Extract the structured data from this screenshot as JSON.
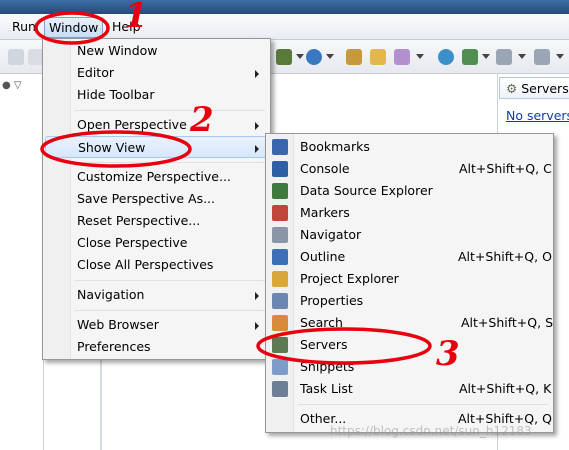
{
  "menubar": {
    "run": "Run",
    "window": "Window",
    "help": "Help"
  },
  "colors": {
    "annotation": "#e8000e",
    "highlight": "#d6e7fb",
    "link": "#0b3fa8"
  },
  "window_menu": {
    "items": [
      {
        "label": "New Window"
      },
      {
        "label": "Editor",
        "submenu": true
      },
      {
        "label": "Hide Toolbar"
      },
      {
        "label": "Open Perspective",
        "submenu": true
      },
      {
        "label": "Show View",
        "submenu": true,
        "highlighted": true
      },
      {
        "label": "Customize Perspective..."
      },
      {
        "label": "Save Perspective As..."
      },
      {
        "label": "Reset Perspective..."
      },
      {
        "label": "Close Perspective"
      },
      {
        "label": "Close All Perspectives"
      },
      {
        "label": "Navigation",
        "submenu": true
      },
      {
        "label": "Web Browser",
        "submenu": true
      },
      {
        "label": "Preferences"
      }
    ]
  },
  "show_view_menu": {
    "items": [
      {
        "label": "Bookmarks",
        "icon": "bookmarks-icon",
        "accel": ""
      },
      {
        "label": "Console",
        "icon": "console-icon",
        "accel": "Alt+Shift+Q, C"
      },
      {
        "label": "Data Source Explorer",
        "icon": "data-source-icon",
        "accel": ""
      },
      {
        "label": "Markers",
        "icon": "markers-icon",
        "accel": ""
      },
      {
        "label": "Navigator",
        "icon": "navigator-icon",
        "accel": ""
      },
      {
        "label": "Outline",
        "icon": "outline-icon",
        "accel": "Alt+Shift+Q, O"
      },
      {
        "label": "Project Explorer",
        "icon": "project-explorer-icon",
        "accel": ""
      },
      {
        "label": "Properties",
        "icon": "properties-icon",
        "accel": ""
      },
      {
        "label": "Search",
        "icon": "search-icon",
        "accel": "Alt+Shift+Q, S"
      },
      {
        "label": "Servers",
        "icon": "servers-icon",
        "accel": ""
      },
      {
        "label": "Snippets",
        "icon": "snippets-icon",
        "accel": ""
      },
      {
        "label": "Task List",
        "icon": "task-list-icon",
        "accel": "Alt+Shift+Q, K"
      },
      {
        "label": "Other...",
        "icon": "",
        "accel": "Alt+Shift+Q, Q"
      }
    ]
  },
  "servers_view": {
    "tab_label": "Servers",
    "link_text": "No servers"
  },
  "annotations": [
    "1",
    "2",
    "3"
  ],
  "watermark": "https://blog.csdn.net/sun_h12183"
}
